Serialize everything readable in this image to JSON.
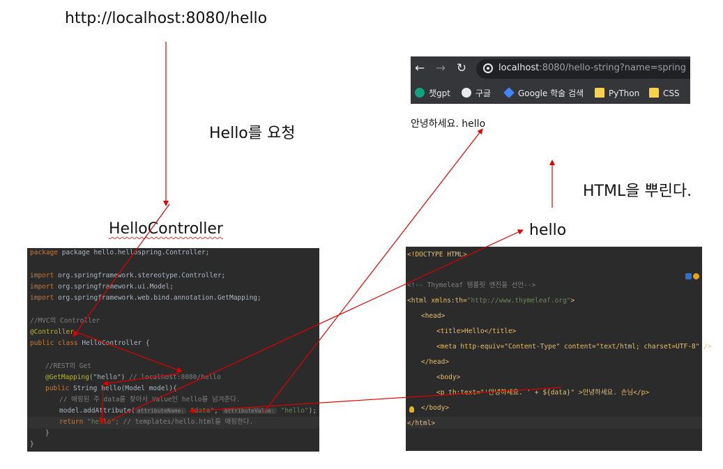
{
  "labels": {
    "url": "http://localhost:8080/hello",
    "request": "Hello를 요청",
    "controller_title": "HelloController",
    "render": "HTML을 뿌린다.",
    "hello": "hello"
  },
  "browser": {
    "url_host": "localhost",
    "url_rest": ":8080/hello-string?name=spring",
    "bookmarks": [
      "챗gpt",
      "구글",
      "Google 학술 검색",
      "PyThon",
      "CSS"
    ],
    "page_text": "안녕하세요. hello"
  },
  "java": {
    "l_package": "package hello.hellospring.Controller;",
    "l_imp1": "org.springframework.stereotype.Controller;",
    "l_imp2": "org.springframework.ui.Model;",
    "l_imp3": "org.springframework.web.bind.annotation.GetMapping;",
    "l_cmt_mvc": "//MVC의 Controller",
    "l_ann_controller": "@Controller",
    "l_class": "HelloController {",
    "l_cmt_rest": "//REST의 Get",
    "l_getmapping": "@GetMapping",
    "l_getmapping_arg": "(\"hello\")",
    "l_getmapping_cmt": " // localhost:8080/hello",
    "l_method": "String hello(Model model){",
    "l_cmt_map": "// 매핑된 주 data를 찾아서 Value인 hello를 넘겨준다.",
    "l_addattr": "model.addAttribute(",
    "hint_name": "attributeName:",
    "v_data": "\"data\"",
    "hint_value": "attributeValue:",
    "v_hello": "\"hello\"",
    "l_addattr_end": ");",
    "l_return_val": "\"hello\"",
    "l_return_cmt": "; // templates/hello.html을 매핑한다.",
    "l_close1": "}",
    "l_close2": "}"
  },
  "html": {
    "l_doctype": "<!DOCTYPE HTML>",
    "l_cmt": "<!-- Thymeleaf 템플릿 엔진을 선언-->",
    "l_html": "<html xmlns:th=",
    "l_html_ns": "\"http://www.thymeleaf.org\"",
    "l_html_end": ">",
    "l_head": "<head>",
    "l_title": "<title>Hello</title>",
    "l_meta": "<meta http-equiv=\"Content-Type\" content=\"text/html; charset=UTF-8\" />",
    "l_head_close": "</head>",
    "l_body": "<body>",
    "l_p": "<p th:text=\"'안녕하세요. ' + ${data}\" >안녕하세요. 손님</p>",
    "l_body_close": "</body>",
    "l_html_close": "</html>"
  },
  "colors": {
    "arrow": "#e00000",
    "editor_bg": "#2b2b2b",
    "browser_bg": "#35363a"
  }
}
